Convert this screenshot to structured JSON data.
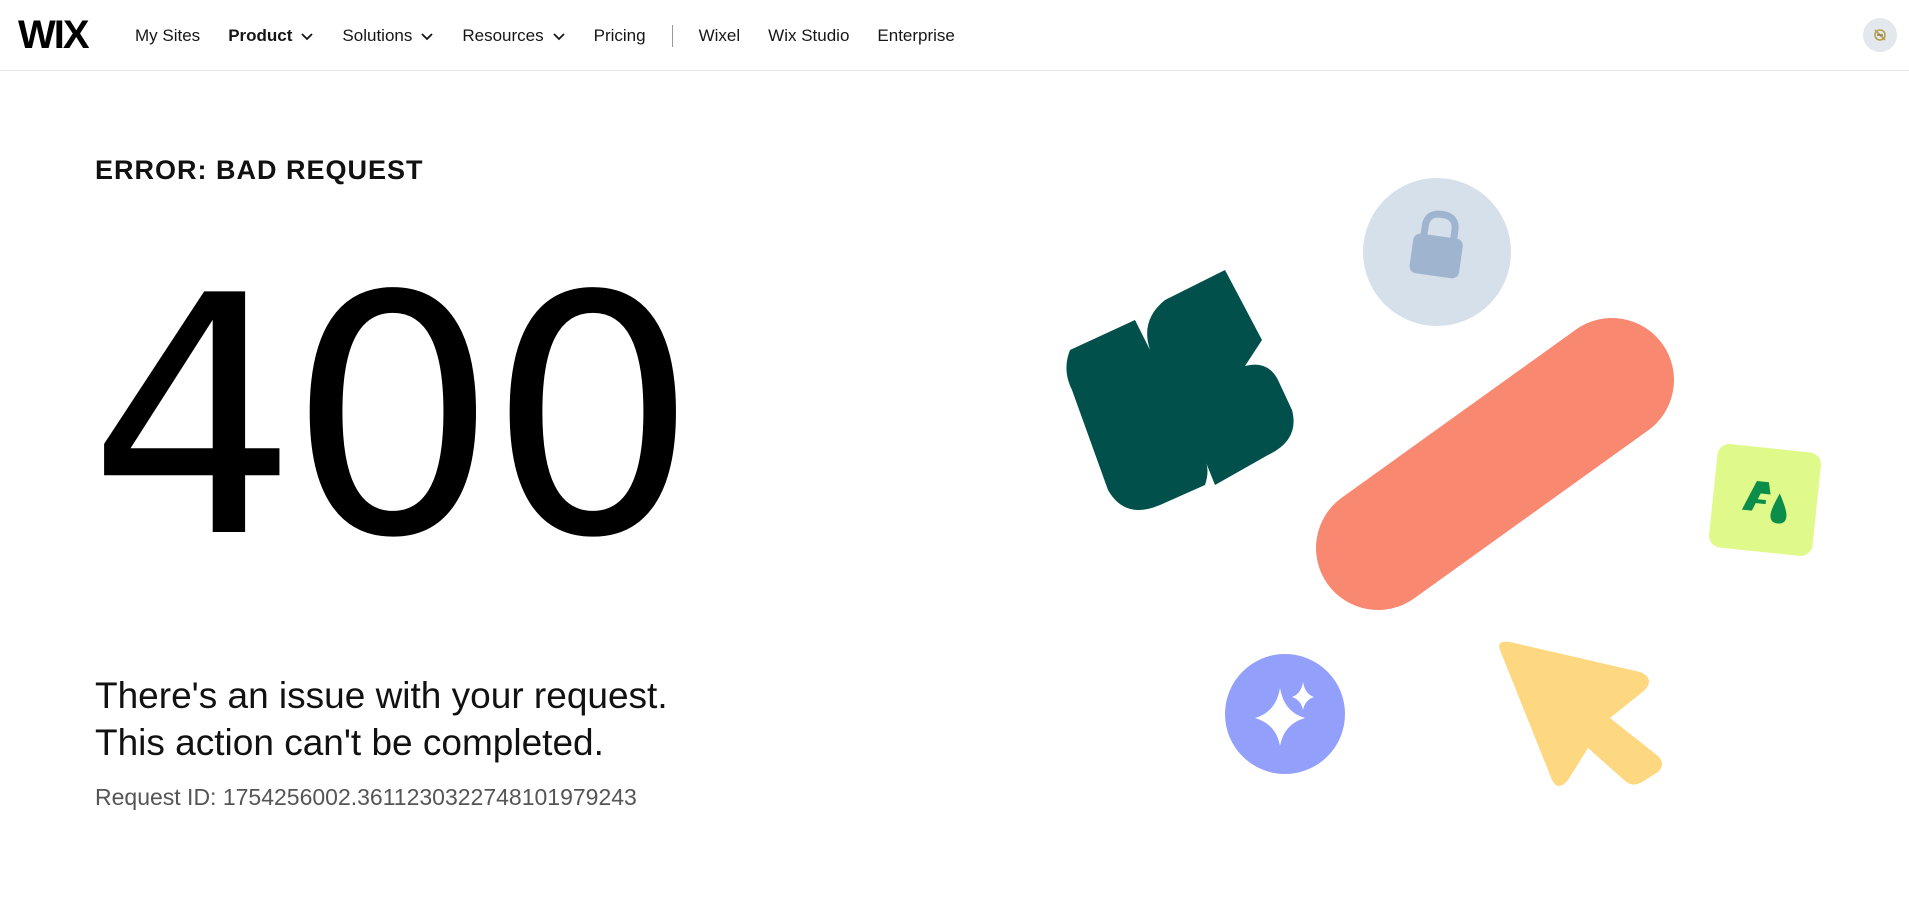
{
  "header": {
    "logo": "WIX",
    "nav": [
      {
        "label": "My Sites",
        "dropdown": false,
        "bold": false
      },
      {
        "label": "Product",
        "dropdown": true,
        "bold": true
      },
      {
        "label": "Solutions",
        "dropdown": true,
        "bold": false
      },
      {
        "label": "Resources",
        "dropdown": true,
        "bold": false
      },
      {
        "label": "Pricing",
        "dropdown": false,
        "bold": false
      }
    ],
    "nav_secondary": [
      {
        "label": "Wixel"
      },
      {
        "label": "Wix Studio"
      },
      {
        "label": "Enterprise"
      }
    ],
    "avatar_icon": "user-avatar-icon"
  },
  "error": {
    "label": "ERROR: BAD REQUEST",
    "code": "400",
    "message_line1": "There's an issue with your request.",
    "message_line2": "This action can't be completed.",
    "request_id": "Request ID: 1754256002.3611230322748101979243"
  },
  "illustration": {
    "colors": {
      "teal_shape": "#02504c",
      "lock_circle": "#d6e0eb",
      "lock_icon": "#9fb4cf",
      "coral_pill": "#f88870",
      "green_tile": "#dff98a",
      "green_icon": "#0b8e4a",
      "sparkle_circle": "#929ffb",
      "cursor": "#fdd880"
    },
    "icons": [
      "lock-icon",
      "sparkle-icon",
      "cursor-icon",
      "font-color-icon"
    ]
  }
}
